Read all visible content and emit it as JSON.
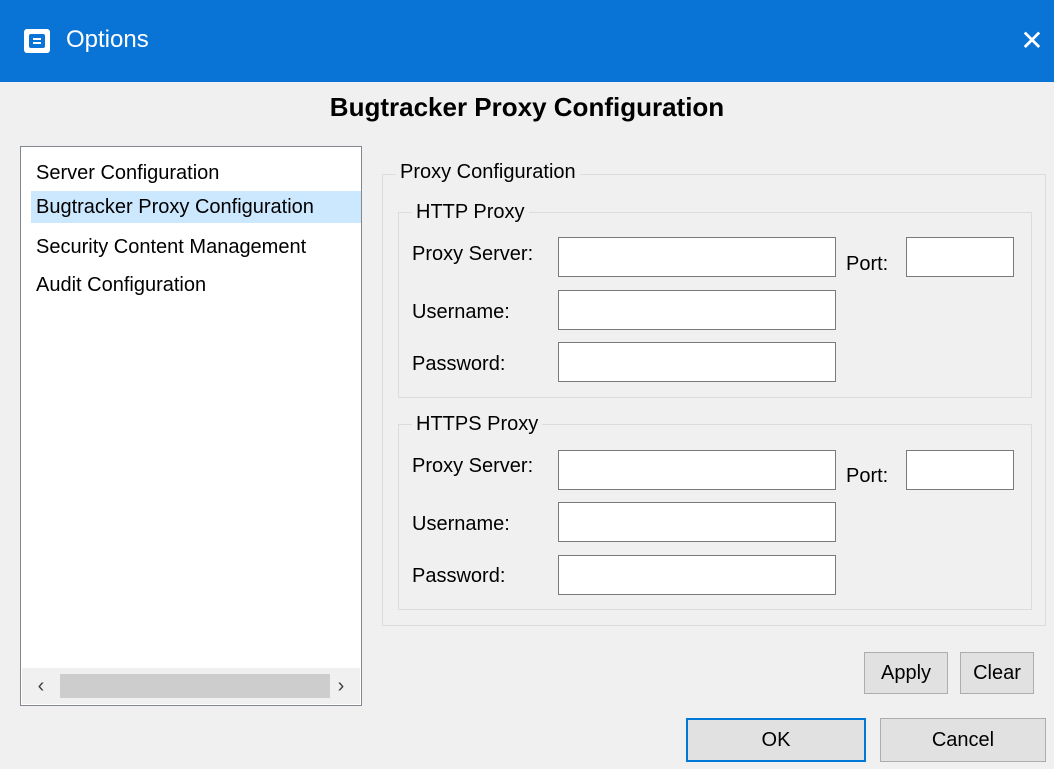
{
  "window": {
    "title": "Options",
    "icon": "app-icon",
    "close_icon": "close-icon"
  },
  "heading": "Bugtracker Proxy Configuration",
  "sidebar": {
    "items": [
      {
        "label": "Server Configuration",
        "selected": false
      },
      {
        "label": "Bugtracker Proxy Configuration",
        "selected": true
      },
      {
        "label": "Security Content Management",
        "selected": false
      },
      {
        "label": "Audit Configuration",
        "selected": false
      }
    ],
    "scroll_left": "‹",
    "scroll_right": "›"
  },
  "proxy_config": {
    "legend": "Proxy Configuration",
    "http": {
      "legend": "HTTP Proxy",
      "server_label": "Proxy Server:",
      "server_value": "",
      "port_label": "Port:",
      "port_value": "",
      "username_label": "Username:",
      "username_value": "",
      "password_label": "Password:",
      "password_value": ""
    },
    "https": {
      "legend": "HTTPS Proxy",
      "server_label": "Proxy Server:",
      "server_value": "",
      "port_label": "Port:",
      "port_value": "",
      "username_label": "Username:",
      "username_value": "",
      "password_label": "Password:",
      "password_value": ""
    }
  },
  "buttons": {
    "apply": "Apply",
    "clear": "Clear",
    "ok": "OK",
    "cancel": "Cancel"
  },
  "colors": {
    "titlebar": "#0a74d6",
    "selection": "#cce8ff",
    "default_button_border": "#0078d7"
  }
}
